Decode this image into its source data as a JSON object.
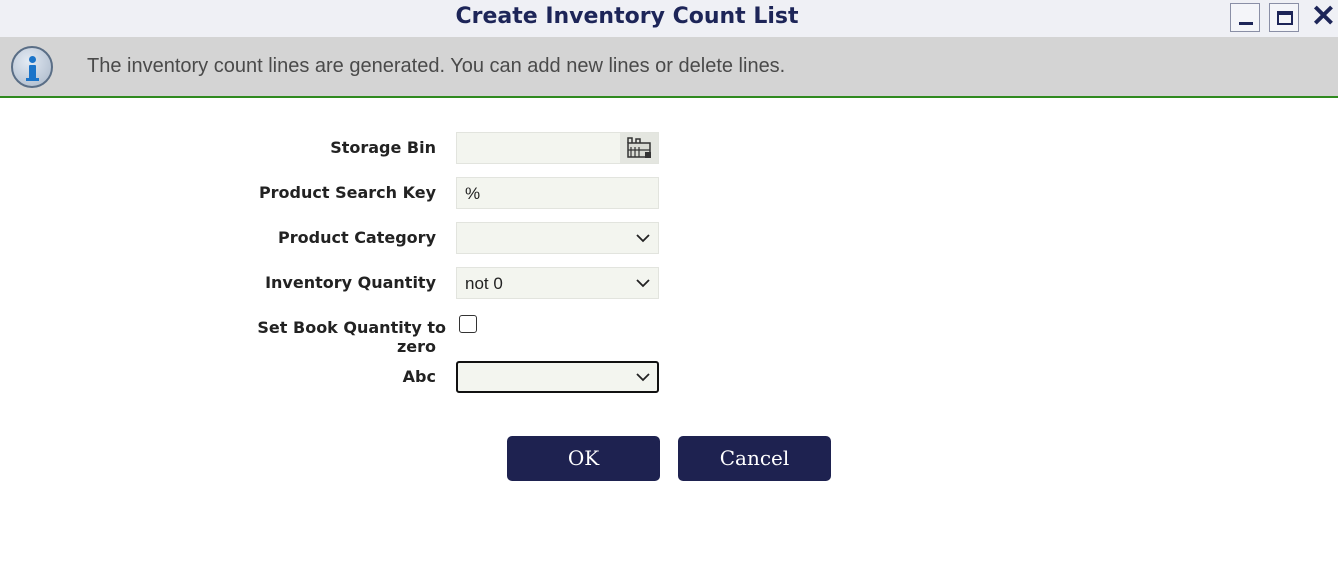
{
  "window": {
    "title": "Create Inventory Count List",
    "controls": {
      "minimize_icon": "minimize-icon",
      "maximize_icon": "maximize-icon",
      "close_glyph": "✕"
    }
  },
  "info": {
    "icon": "info-icon",
    "message": "The inventory count lines are generated. You can add new lines or delete lines."
  },
  "form": {
    "storage_bin": {
      "label": "Storage Bin",
      "value": "",
      "icon": "warehouse-locator-icon"
    },
    "product_search_key": {
      "label": "Product Search Key",
      "value": "%"
    },
    "product_category": {
      "label": "Product Category",
      "value": ""
    },
    "inventory_quantity": {
      "label": "Inventory Quantity",
      "value": "not 0"
    },
    "set_book_quantity": {
      "label_line1": "Set Book Quantity to",
      "label_line2": "zero",
      "checked": false
    },
    "abc": {
      "label": "Abc",
      "value": ""
    }
  },
  "buttons": {
    "ok": "OK",
    "cancel": "Cancel"
  },
  "colors": {
    "title": "#1d2558",
    "button_bg": "#1e2250",
    "info_border": "#2f8a1f",
    "field_bg": "#f3f5ef"
  }
}
